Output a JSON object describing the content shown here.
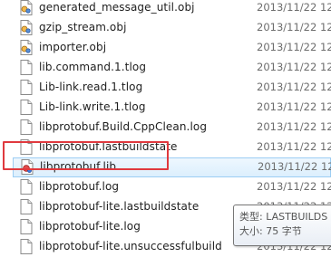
{
  "files": [
    {
      "name": "generated_message_util.obj",
      "date": "2013/11/22 12",
      "icon": "obj-file-icon"
    },
    {
      "name": "gzip_stream.obj",
      "date": "2013/11/22 12",
      "icon": "obj-file-icon"
    },
    {
      "name": "importer.obj",
      "date": "2013/11/22 12",
      "icon": "obj-file-icon"
    },
    {
      "name": "lib.command.1.tlog",
      "date": "2013/11/22 12",
      "icon": "document-file-icon"
    },
    {
      "name": "Lib-link.read.1.tlog",
      "date": "2013/11/22 12",
      "icon": "document-file-icon"
    },
    {
      "name": "Lib-link.write.1.tlog",
      "date": "2013/11/22 12",
      "icon": "document-file-icon"
    },
    {
      "name": "libprotobuf.Build.CppClean.log",
      "date": "2013/11/22 12",
      "icon": "document-file-icon"
    },
    {
      "name": "libprotobuf.lastbuildstate",
      "date": "2013/11/22 12",
      "icon": "document-file-icon"
    },
    {
      "name": "libprotobuf.lib",
      "date": "2013/11/22 12",
      "icon": "lib-file-icon",
      "selected": true
    },
    {
      "name": "libprotobuf.log",
      "date": "2013/11/22 12",
      "icon": "document-file-icon"
    },
    {
      "name": "libprotobuf-lite.lastbuildstate",
      "date": "2013/11/22 12",
      "icon": "document-file-icon"
    },
    {
      "name": "libprotobuf-lite.log",
      "date": "2013/11/22 12",
      "icon": "document-file-icon"
    },
    {
      "name": "libprotobuf-lite.unsuccessfulbuild",
      "date": "2013/11/22 12",
      "icon": "document-file-icon"
    }
  ],
  "tooltip": {
    "type_line": "类型: LASTBUILDS",
    "size_line": "大小: 75 字节"
  },
  "colors": {
    "selection_fill": "#dceffd",
    "selection_border": "#9ccdf3",
    "annotation_border": "#e0393e",
    "date_text": "#6d6d6d"
  }
}
